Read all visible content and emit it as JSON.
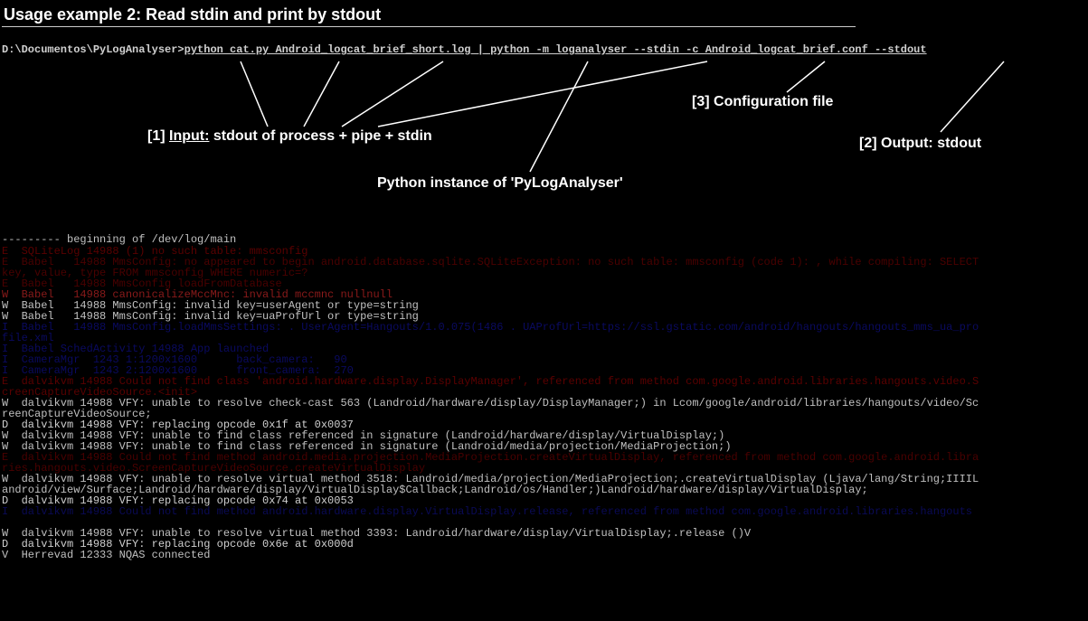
{
  "title": "Usage example 2: Read stdin and print by stdout",
  "command": {
    "prompt": "D:\\Documentos\\PyLogAnalyser>",
    "body": "python cat.py Android_logcat_brief_short.log | python -m loganalyser --stdin -c Android_logcat_brief.conf --stdout"
  },
  "annotations": {
    "input_num": "[1]",
    "input_key": "Input:",
    "input_rest": " stdout of process + pipe + stdin",
    "output_num": "[2]",
    "output_text": " Output: stdout",
    "conf_num": "[3]",
    "conf_text": " Configuration file",
    "python_inst": "Python instance of 'PyLogAnalyser'"
  },
  "separator": "--------- beginning of /dev/log/main",
  "lines": [
    {
      "cls": "c-err-dim",
      "t": "E  SQLiteLog 14988 (1) no such table: mmsconfig"
    },
    {
      "cls": "c-err-dim2",
      "t": "E  Babel   14988 MmsConfig: no appeared to begin android.database.sqlite.SQLiteException: no such table: mmsconfig (code 1): , while compiling: SELECT"
    },
    {
      "cls": "c-err-dim2",
      "t": "key, value, type FROM mmsconfig WHERE numeric=?"
    },
    {
      "cls": "c-err-dim2",
      "t": "E  Babel   14988 MmsConfig loadFromDatabase"
    },
    {
      "cls": "c-warn-red",
      "t": "W  Babel   14988 canonicalizeMccMnc: invalid mccmnc nullnull"
    },
    {
      "cls": "c-warn",
      "t": "W  Babel   14988 MmsConfig: invalid key=userAgent or type=string"
    },
    {
      "cls": "c-warn",
      "t": "W  Babel   14988 MmsConfig: invalid key=uaProfUrl or type=string"
    },
    {
      "cls": "c-info-blue",
      "t": "I  Babel   14988 MmsConfig.loadMmsSettings: . UserAgent=Hangouts/1.0.075(1486 . UAProfUrl=https://ssl.gstatic.com/android/hangouts/hangouts_mms_ua_pro"
    },
    {
      "cls": "c-info-blue",
      "t": "file.xml"
    },
    {
      "cls": "c-info-blue",
      "t": "I  Babel SchedActivity 14988 App launched"
    },
    {
      "cls": "c-info-blue",
      "t": "I  CameraMgr  1243 1:1200x1600      back_camera:   90"
    },
    {
      "cls": "c-info-blue",
      "t": "I  CameraMgr  1243 2:1200x1600      front_camera:  270"
    },
    {
      "cls": "c-err-dim",
      "t": "E  dalvikvm 14988 Could not find class 'android.hardware.display.DisplayManager', referenced from method com.google.android.libraries.hangouts.video.S"
    },
    {
      "cls": "c-err-dim",
      "t": "creenCaptureVideoSource.<init>"
    },
    {
      "cls": "c-warn",
      "t": "W  dalvikvm 14988 VFY: unable to resolve check-cast 563 (Landroid/hardware/display/DisplayManager;) in Lcom/google/android/libraries/hangouts/video/Sc"
    },
    {
      "cls": "c-warn",
      "t": "reenCaptureVideoSource;"
    },
    {
      "cls": "c-d",
      "t": "D  dalvikvm 14988 VFY: replacing opcode 0x1f at 0x0037"
    },
    {
      "cls": "c-warn",
      "t": "W  dalvikvm 14988 VFY: unable to find class referenced in signature (Landroid/hardware/display/VirtualDisplay;)"
    },
    {
      "cls": "c-warn",
      "t": "W  dalvikvm 14988 VFY: unable to find class referenced in signature (Landroid/media/projection/MediaProjection;)"
    },
    {
      "cls": "c-err-dim2",
      "t": "E  dalvikvm 14988 Could not find method android.media.projection.MediaProjection.createVirtualDisplay, referenced from method com.google.android.libra"
    },
    {
      "cls": "c-err-dim2",
      "t": "ries.hangouts.video.ScreenCaptureVideoSource.createVirtualDisplay"
    },
    {
      "cls": "c-warn",
      "t": "W  dalvikvm 14988 VFY: unable to resolve virtual method 3518: Landroid/media/projection/MediaProjection;.createVirtualDisplay (Ljava/lang/String;IIIIL"
    },
    {
      "cls": "c-warn",
      "t": "android/view/Surface;Landroid/hardware/display/VirtualDisplay$Callback;Landroid/os/Handler;)Landroid/hardware/display/VirtualDisplay;"
    },
    {
      "cls": "c-d",
      "t": "D  dalvikvm 14988 VFY: replacing opcode 0x74 at 0x0053"
    },
    {
      "cls": "c-info-blue2",
      "t": "I  dalvikvm 14988 Could not find method android.hardware.display.VirtualDisplay.release, referenced from method com.google.android.libraries.hangouts"
    },
    {
      "cls": "c-info-blue2",
      "t": " "
    },
    {
      "cls": "c-warn",
      "t": "W  dalvikvm 14988 VFY: unable to resolve virtual method 3393: Landroid/hardware/display/VirtualDisplay;.release ()V"
    },
    {
      "cls": "c-d",
      "t": "D  dalvikvm 14988 VFY: replacing opcode 0x6e at 0x000d"
    },
    {
      "cls": "c-v",
      "t": "V  Herrevad 12333 NQAS connected"
    }
  ]
}
